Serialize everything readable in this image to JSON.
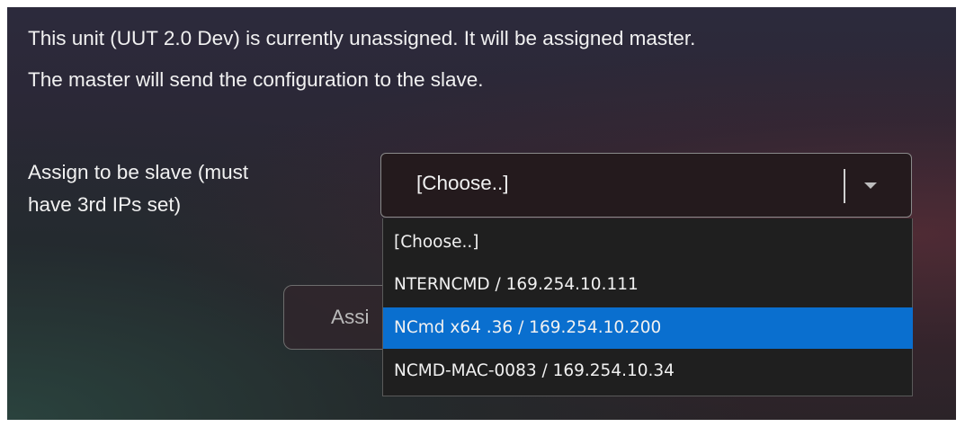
{
  "message": {
    "line1": "This unit (UUT 2.0 Dev) is currently unassigned. It will be assigned master.",
    "line2": "The master will send the configuration to the slave."
  },
  "assign_slave": {
    "label": "Assign to be slave (must\nhave 3rd IPs set)",
    "selected_value": "[Choose..]",
    "options": [
      "[Choose..]",
      "NTERNCMD / 169.254.10.111",
      "NCmd x64 .36 / 169.254.10.200",
      "NCMD-MAC-0083 / 169.254.10.34"
    ],
    "highlighted_option": "NCmd x64 .36 / 169.254.10.200"
  },
  "assign_button": {
    "label": "Assi"
  },
  "colors": {
    "highlight": "#0a6fcf",
    "text": "#f1f1f1",
    "dropdown_bg": "#1f1f1f"
  },
  "icons": {
    "select_arrow": "chevron-down-icon"
  }
}
